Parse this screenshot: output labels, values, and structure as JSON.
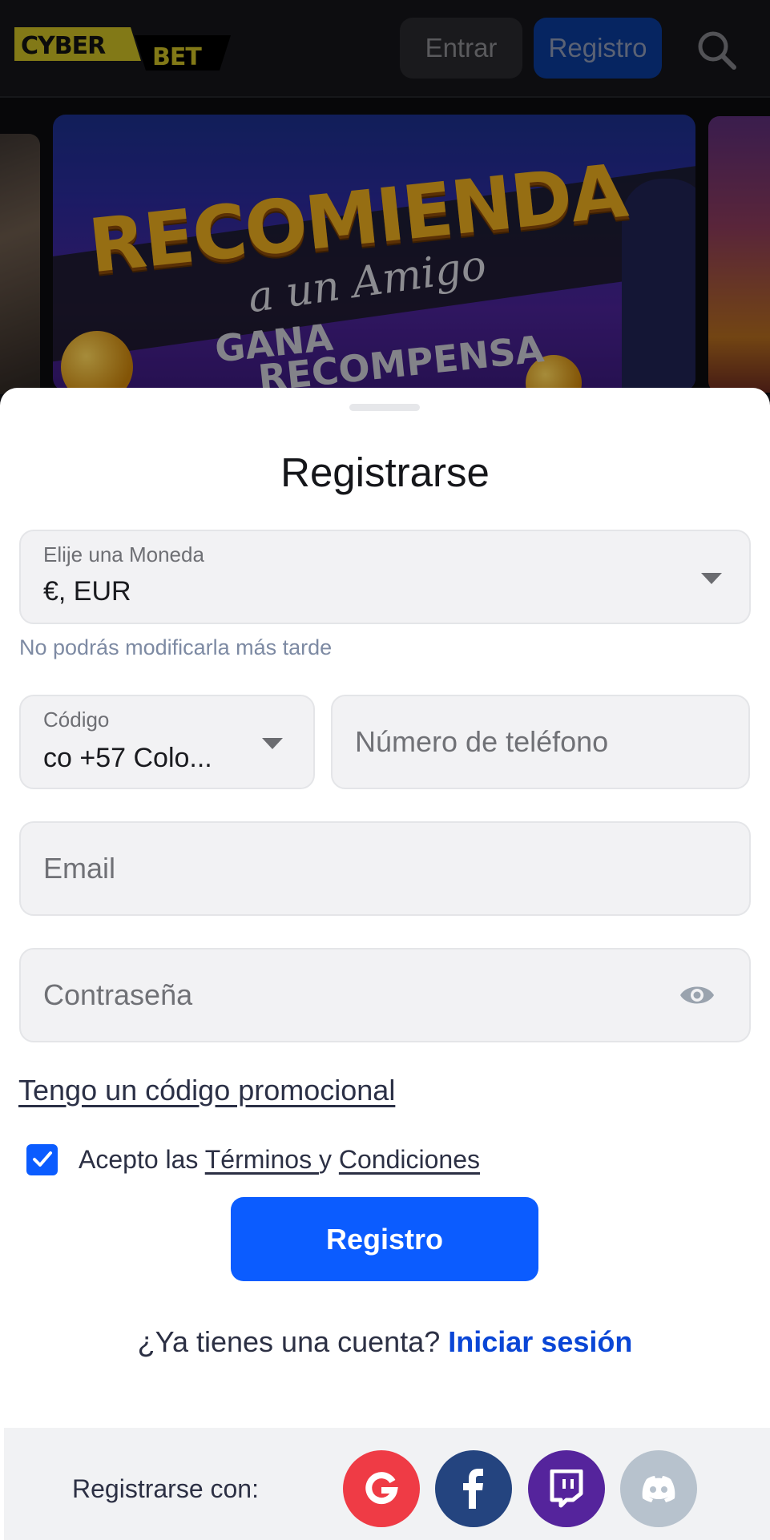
{
  "header": {
    "logo_top": "CYBER",
    "logo_bottom": "BET",
    "login_label": "Entrar",
    "register_label": "Registro",
    "search_icon": "search-icon",
    "colors": {
      "logo_yellow": "#f3e02b",
      "register_bg": "#0a3a95"
    }
  },
  "banner": {
    "title": "RECOMIENDA",
    "subtitle": "a un Amigo",
    "line1": "GANA",
    "line2": "RECOMPENSA"
  },
  "form": {
    "title": "Registrarse",
    "currency": {
      "label": "Elije una Moneda",
      "value": "€, EUR",
      "helper": "No podrás modificarla más tarde"
    },
    "code": {
      "label": "Código",
      "value": "co +57 Colo..."
    },
    "phone": {
      "placeholder": "Número de teléfono"
    },
    "email": {
      "placeholder": "Email"
    },
    "password": {
      "placeholder": "Contraseña",
      "toggle_icon": "eye-icon"
    },
    "promo_link": "Tengo un código promocional",
    "terms": {
      "checked": true,
      "prefix": "Acepto las ",
      "link1": "Términos ",
      "middle": "y ",
      "link2": "Condiciones"
    },
    "submit_label": "Registro",
    "login_prompt": "¿Ya tienes una cuenta? ",
    "login_link": "Iniciar sesión",
    "accent": "#0b5cff"
  },
  "social": {
    "label": "Registrarse con:",
    "providers": [
      {
        "name": "Google",
        "glyph": "G",
        "color": "#ef3b45"
      },
      {
        "name": "Facebook",
        "glyph": "f",
        "color": "#24447f"
      },
      {
        "name": "Twitch",
        "glyph": "twitch",
        "color": "#55249c"
      },
      {
        "name": "Discord",
        "glyph": "discord",
        "color": "#b7c2cd"
      }
    ]
  }
}
